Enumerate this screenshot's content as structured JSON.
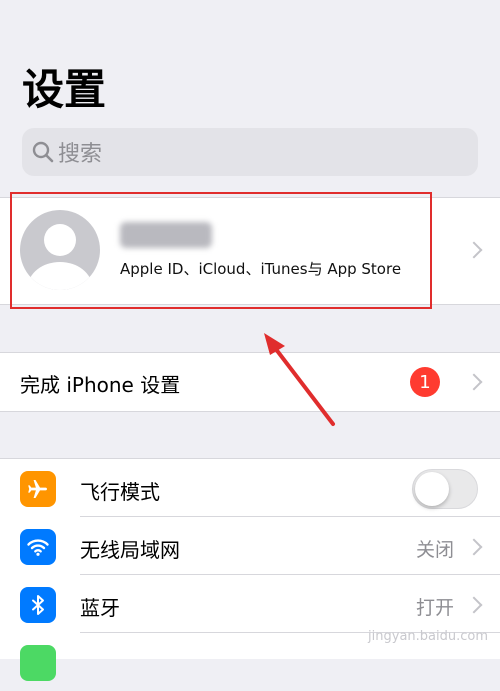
{
  "header": {
    "title": "设置"
  },
  "search": {
    "placeholder": "搜索"
  },
  "profile": {
    "subtitle": "Apple ID、iCloud、iTunes与 App Store"
  },
  "setup": {
    "label": "完成 iPhone 设置",
    "badge": "1"
  },
  "settings": {
    "rows": [
      {
        "label": "飞行模式",
        "icon": "airplane-icon",
        "color": "#ff9500",
        "toggle_on": false
      },
      {
        "label": "无线局域网",
        "icon": "wifi-icon",
        "color": "#007aff",
        "value": "关闭"
      },
      {
        "label": "蓝牙",
        "icon": "bluetooth-icon",
        "color": "#007aff",
        "value": "打开"
      }
    ]
  },
  "colors": {
    "annotation_red": "#e02d2d",
    "badge_red": "#ff3b30"
  }
}
